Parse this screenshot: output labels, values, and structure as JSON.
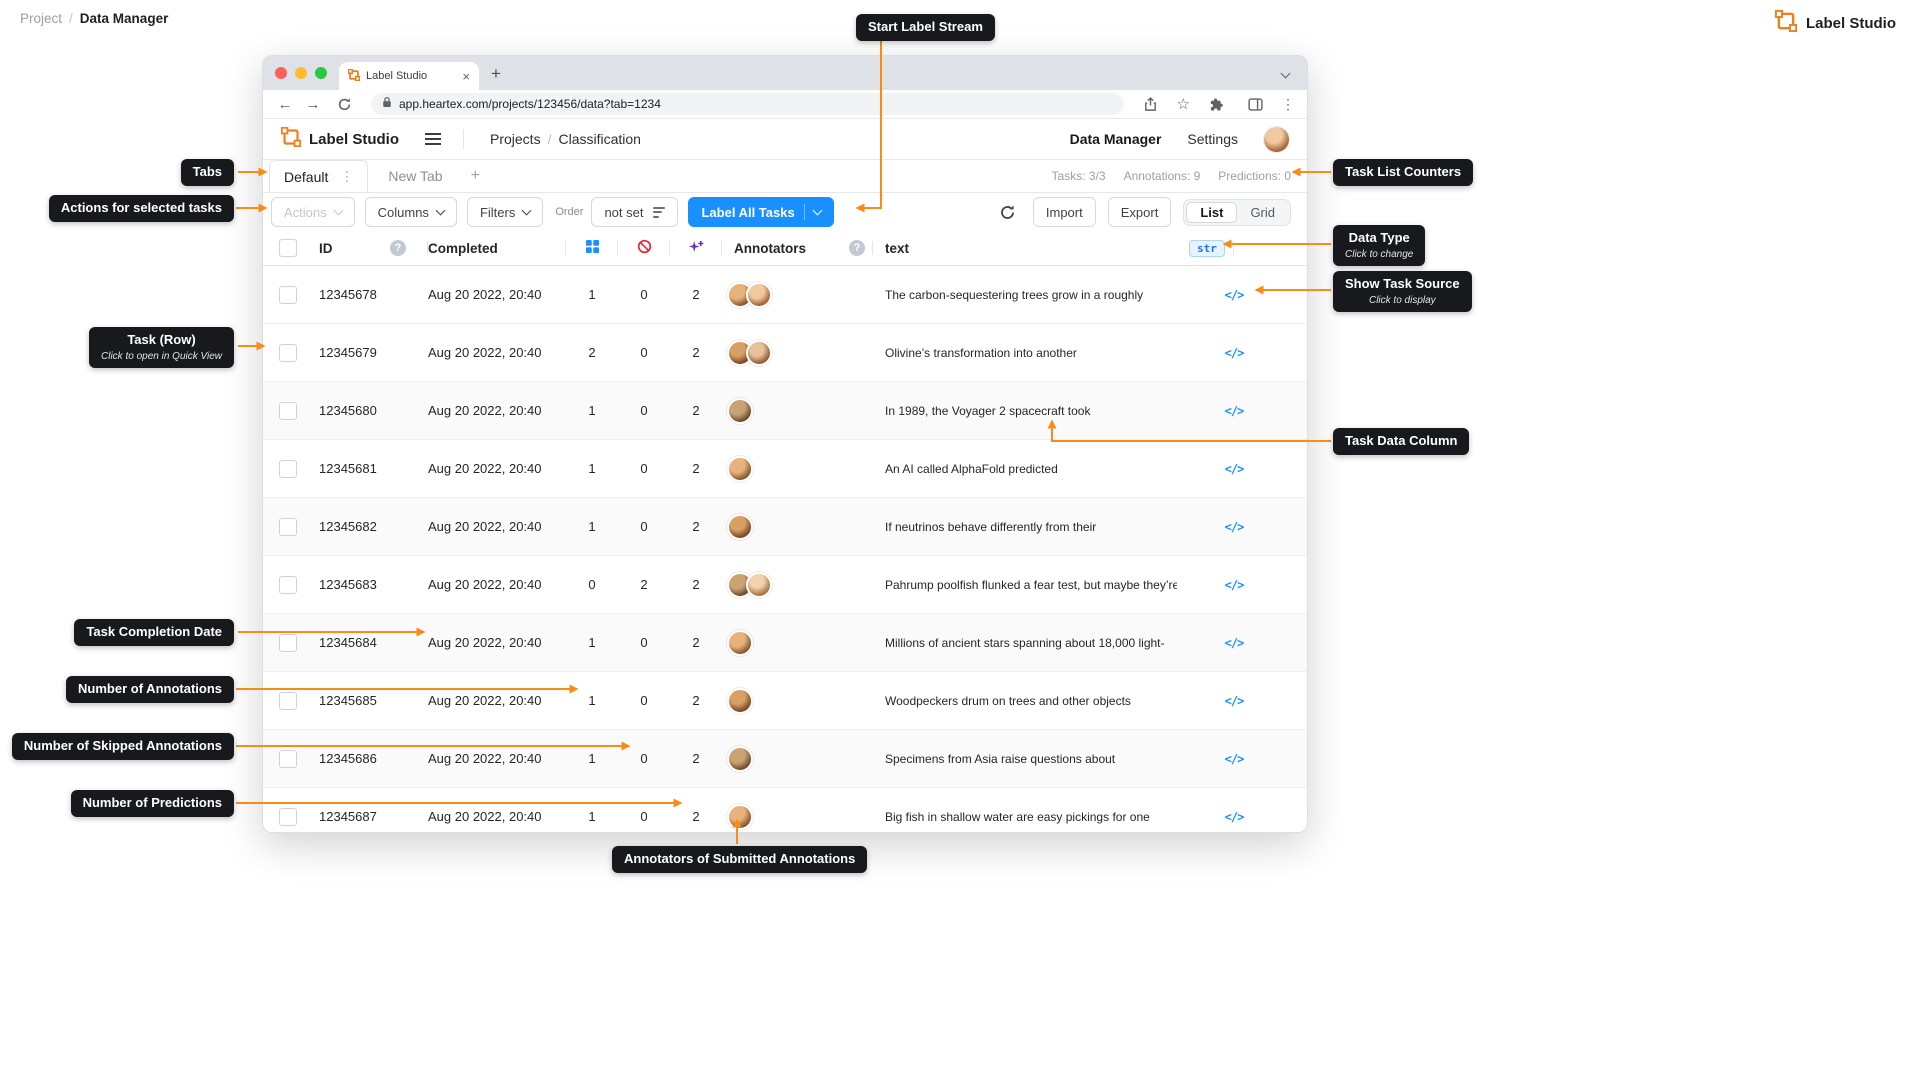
{
  "page": {
    "breadcrumb": {
      "root": "Project",
      "sep": "/",
      "current": "Data Manager"
    },
    "brand": "Label Studio"
  },
  "browser": {
    "tab_title": "Label Studio",
    "url": "app.heartex.com/projects/123456/data?tab=1234"
  },
  "header": {
    "brand": "Label Studio",
    "nav_projects": "Projects",
    "nav_sep": "/",
    "nav_current": "Classification",
    "link_data_manager": "Data Manager",
    "link_settings": "Settings"
  },
  "tabs": {
    "active": "Default",
    "inactive": "New Tab",
    "add": "+",
    "counters": [
      {
        "label": "Tasks: 3/3"
      },
      {
        "label": "Annotations: 9"
      },
      {
        "label": "Predictions: 0"
      }
    ]
  },
  "toolbar": {
    "actions": "Actions",
    "columns": "Columns",
    "filters": "Filters",
    "order_label": "Order",
    "order_value": "not set",
    "label_all_tasks": "Label All Tasks",
    "import": "Import",
    "export": "Export",
    "view_list": "List",
    "view_grid": "Grid"
  },
  "table": {
    "headers": {
      "id": "ID",
      "completed": "Completed",
      "annotators": "Annotators",
      "text": "text"
    },
    "data_type_badge": "str",
    "help_icon": "?",
    "source_icon": "</>",
    "rows": [
      {
        "id": "12345678",
        "completed": "Aug 20 2022, 20:40",
        "annotations": "1",
        "skipped": "0",
        "predictions": "2",
        "avatars": 2,
        "text": "The carbon-sequestering trees grow in a roughly"
      },
      {
        "id": "12345679",
        "completed": "Aug 20 2022, 20:40",
        "annotations": "2",
        "skipped": "0",
        "predictions": "2",
        "avatars": 2,
        "text": "Olivine’s transformation into another"
      },
      {
        "id": "12345680",
        "completed": "Aug 20 2022, 20:40",
        "annotations": "1",
        "skipped": "0",
        "predictions": "2",
        "avatars": 1,
        "text": "In 1989, the Voyager 2 spacecraft took"
      },
      {
        "id": "12345681",
        "completed": "Aug 20 2022, 20:40",
        "annotations": "1",
        "skipped": "0",
        "predictions": "2",
        "avatars": 1,
        "text": "An AI called AlphaFold predicted"
      },
      {
        "id": "12345682",
        "completed": "Aug 20 2022, 20:40",
        "annotations": "1",
        "skipped": "0",
        "predictions": "2",
        "avatars": 1,
        "text": "If neutrinos behave differently from their"
      },
      {
        "id": "12345683",
        "completed": "Aug 20 2022, 20:40",
        "annotations": "0",
        "skipped": "2",
        "predictions": "2",
        "avatars": 2,
        "text": "Pahrump poolfish flunked a fear test, but maybe they’re"
      },
      {
        "id": "12345684",
        "completed": "Aug 20 2022, 20:40",
        "annotations": "1",
        "skipped": "0",
        "predictions": "2",
        "avatars": 1,
        "text": "Millions of ancient stars spanning about 18,000 light-"
      },
      {
        "id": "12345685",
        "completed": "Aug 20 2022, 20:40",
        "annotations": "1",
        "skipped": "0",
        "predictions": "2",
        "avatars": 1,
        "text": "Woodpeckers drum on trees and other objects"
      },
      {
        "id": "12345686",
        "completed": "Aug 20 2022, 20:40",
        "annotations": "1",
        "skipped": "0",
        "predictions": "2",
        "avatars": 1,
        "text": "Specimens from Asia raise questions about"
      },
      {
        "id": "12345687",
        "completed": "Aug 20 2022, 20:40",
        "annotations": "1",
        "skipped": "0",
        "predictions": "2",
        "avatars": 1,
        "text": "Big fish in shallow water are easy pickings for one"
      }
    ]
  },
  "callouts": {
    "start_label_stream": "Start Label Stream",
    "tabs": "Tabs",
    "actions": "Actions for selected tasks",
    "task_list_counters": "Task List Counters",
    "data_type": {
      "title": "Data Type",
      "sub": "Click to change"
    },
    "show_task_source": {
      "title": "Show Task Source",
      "sub": "Click to display"
    },
    "task_row": {
      "title": "Task (Row)",
      "sub": "Click to open in Quick View"
    },
    "task_data_column": "Task Data Column",
    "task_completion_date": "Task Completion Date",
    "number_of_annotations": "Number of Annotations",
    "number_of_skipped": "Number of Skipped Annotations",
    "number_of_predictions": "Number of Predictions",
    "annotators_submitted": "Annotators of Submitted Annotations"
  },
  "colors": {
    "accent_orange": "#fa8c16",
    "primary_blue": "#1890ff",
    "callout_bg": "#17191d",
    "skipped_red": "#f5222d",
    "predictions_purple": "#722ed1",
    "data_type_blue": "#1677ff"
  }
}
